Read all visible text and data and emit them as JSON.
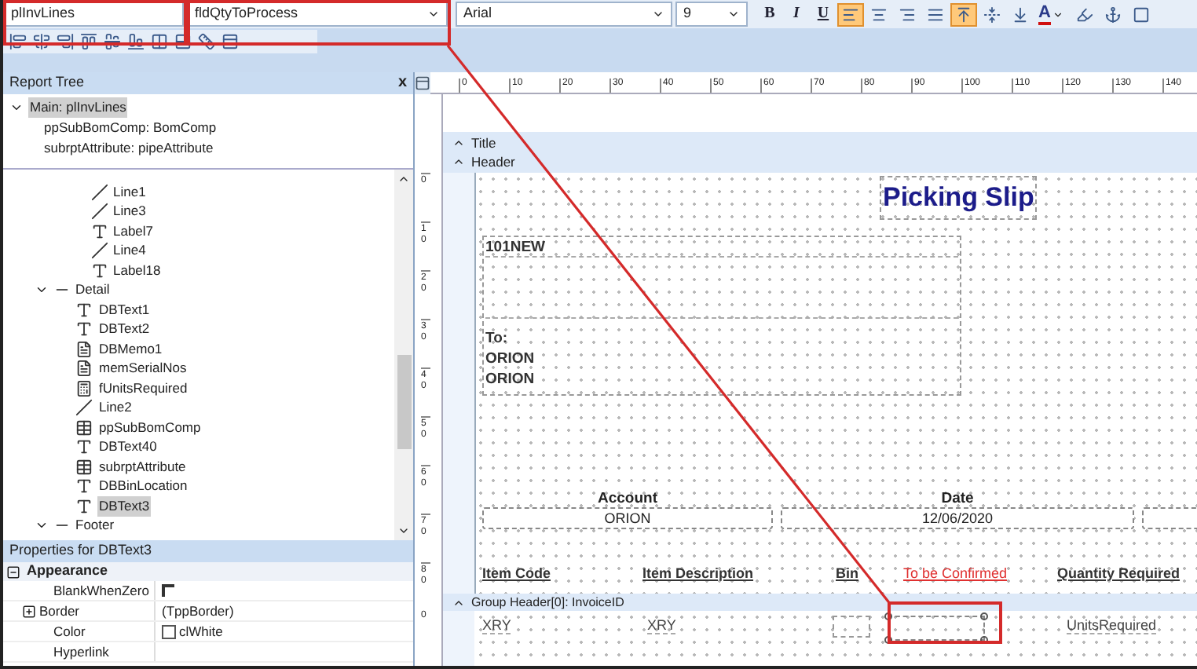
{
  "toolbar": {
    "dataset": "plInvLines",
    "field": "fldQtyToProcess",
    "font": "Arial",
    "size": "9",
    "buttons": [
      {
        "kind": "bold",
        "label": "B",
        "selected": false
      },
      {
        "kind": "italic",
        "label": "I",
        "selected": false
      },
      {
        "kind": "underline",
        "label": "U",
        "selected": false
      },
      {
        "kind": "align-left",
        "selected": true
      },
      {
        "kind": "align-center",
        "selected": false
      },
      {
        "kind": "align-right",
        "selected": false
      },
      {
        "kind": "justify",
        "selected": false
      },
      {
        "kind": "valign-top",
        "selected": true
      },
      {
        "kind": "valign-middle",
        "selected": false
      },
      {
        "kind": "valign-bottom",
        "selected": false
      },
      {
        "kind": "font-color",
        "label": "A",
        "selected": false
      },
      {
        "kind": "highlight",
        "selected": false
      },
      {
        "kind": "anchor",
        "selected": false
      },
      {
        "kind": "border",
        "selected": false
      }
    ]
  },
  "report_tree": {
    "title": "Report Tree",
    "close": "x",
    "main": {
      "label": "Main: plInvLines",
      "expanded": true,
      "selected": true,
      "children": [
        {
          "label": "ppSubBomComp: BomComp"
        },
        {
          "label": "subrptAttribute: pipeAttribute"
        }
      ]
    },
    "scrolled_items": [
      {
        "kind": "line",
        "label": "Line1"
      },
      {
        "kind": "line",
        "label": "Line3"
      },
      {
        "kind": "label",
        "label": "Label7"
      },
      {
        "kind": "line",
        "label": "Line4"
      },
      {
        "kind": "label",
        "label": "Label18"
      }
    ],
    "bands": [
      {
        "label": "Detail",
        "expanded": true,
        "children": [
          {
            "kind": "dbtext",
            "label": "DBText1",
            "selected": false
          },
          {
            "kind": "dbtext",
            "label": "DBText2",
            "selected": false
          },
          {
            "kind": "memo",
            "label": "DBMemo1",
            "selected": false
          },
          {
            "kind": "memo",
            "label": "memSerialNos",
            "selected": false
          },
          {
            "kind": "calc",
            "label": "fUnitsRequired",
            "selected": false
          },
          {
            "kind": "line",
            "label": "Line2",
            "selected": false
          },
          {
            "kind": "subreport",
            "label": "ppSubBomComp",
            "selected": false
          },
          {
            "kind": "dbtext",
            "label": "DBText40",
            "selected": false
          },
          {
            "kind": "subreport",
            "label": "subrptAttribute",
            "selected": false
          },
          {
            "kind": "dbtext",
            "label": "DBBinLocation",
            "selected": false
          },
          {
            "kind": "dbtext",
            "label": "DBText3",
            "selected": true
          }
        ]
      },
      {
        "label": "Footer",
        "expanded": true
      }
    ]
  },
  "properties": {
    "title": "Properties for DBText3",
    "categories": [
      {
        "label": "Appearance",
        "expanded": true,
        "rows": [
          {
            "name": "BlankWhenZero",
            "kind": "checkbox",
            "checked": false
          },
          {
            "name": "Border",
            "kind": "expandable",
            "expanded": false,
            "value": "(TppBorder)"
          },
          {
            "name": "Color",
            "kind": "color",
            "color": "#ffffff",
            "value": "clWhite"
          },
          {
            "name": "Hyperlink",
            "kind": "text"
          }
        ]
      }
    ]
  },
  "designer": {
    "ruler": [
      "0",
      "10",
      "20",
      "30",
      "40",
      "50",
      "60",
      "70",
      "80",
      "90",
      "100",
      "110",
      "120",
      "130",
      "140"
    ],
    "vruler": [
      "0",
      "10",
      "20",
      "30",
      "40",
      "50",
      "60",
      "70",
      "80"
    ],
    "bands": [
      {
        "label": "Title"
      },
      {
        "label": "Header"
      }
    ],
    "header": {
      "title": "Picking Slip",
      "address_lines": [
        "101NEW"
      ],
      "to_label": "To:",
      "to_lines": [
        "ORION",
        "ORION"
      ],
      "info_columns": [
        {
          "heading": "Account",
          "value": "ORION"
        },
        {
          "heading": "Date",
          "value": "12/06/2020"
        }
      ],
      "columns": [
        {
          "label": "Item Code",
          "kind": "normal"
        },
        {
          "label": "Item Description",
          "kind": "normal"
        },
        {
          "label": "Bin",
          "kind": "normal"
        },
        {
          "label": "To be Confirmed",
          "kind": "warning"
        },
        {
          "label": "Quantity Required",
          "kind": "normal"
        }
      ]
    },
    "group_header": {
      "label": "Group Header[0]: InvoiceID",
      "vruler": "0"
    },
    "detail_cells": [
      {
        "kind": "text",
        "text": "XRY"
      },
      {
        "kind": "text",
        "text": "XRY"
      },
      {
        "kind": "empty"
      },
      {
        "kind": "selected"
      },
      {
        "kind": "text",
        "text": "UnitsRequired"
      }
    ]
  }
}
